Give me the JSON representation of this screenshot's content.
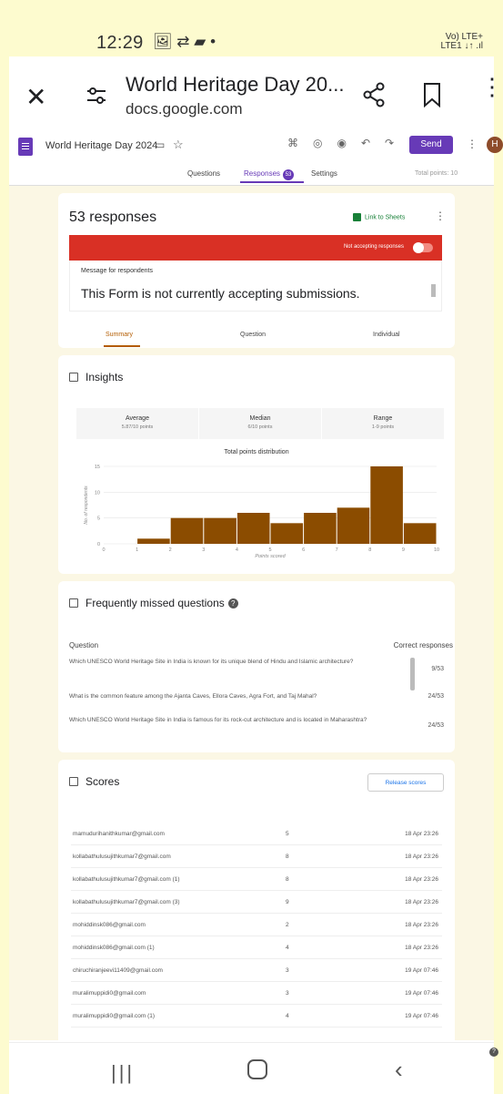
{
  "status_bar": {
    "time": "12:29",
    "icons": "🖼 ⇄ ▰ •",
    "network": "Vo) LTE+",
    "network2": "LTE1 ↓↑ .ıl"
  },
  "browser": {
    "title": "World Heritage Day 20...",
    "url": "docs.google.com"
  },
  "forms_bar": {
    "form_name": "World Heritage Day 2024",
    "send_label": "Send",
    "avatar_letter": "H",
    "tabs": {
      "questions": "Questions",
      "responses": "Responses",
      "responses_badge": "53",
      "settings": "Settings"
    },
    "total_points": "Total points: 10"
  },
  "responses_card": {
    "count_label": "53 responses",
    "link_to_sheets": "Link to Sheets",
    "banner_text": "Not accepting responses",
    "message_label": "Message for respondents",
    "message_text": "This Form is not currently accepting submissions.",
    "subtabs": {
      "summary": "Summary",
      "question": "Question",
      "individual": "Individual"
    }
  },
  "insights": {
    "title": "Insights",
    "average": {
      "label": "Average",
      "value": "5.87/10 points"
    },
    "median": {
      "label": "Median",
      "value": "6/10 points"
    },
    "range": {
      "label": "Range",
      "value": "1-9 points"
    }
  },
  "chart_data": {
    "type": "bar",
    "title": "Total points distribution",
    "xlabel": "Points scored",
    "ylabel": "No. of respondents",
    "categories": [
      "0",
      "1",
      "2",
      "3",
      "4",
      "5",
      "6",
      "7",
      "8",
      "9",
      "10"
    ],
    "values": [
      0,
      1,
      5,
      5,
      6,
      4,
      6,
      7,
      15,
      4,
      0
    ],
    "ylim": [
      0,
      15
    ],
    "yticks": [
      0,
      5,
      10,
      15
    ],
    "bar_color": "#8b4c00",
    "grid": true
  },
  "missed_questions": {
    "title": "Frequently missed questions",
    "header_question": "Question",
    "header_correct": "Correct responses",
    "rows": [
      {
        "question": "Which UNESCO World Heritage Site in India is known for its unique blend of Hindu and Islamic architecture?",
        "correct": "9/53"
      },
      {
        "question": "What is the common feature among the Ajanta Caves, Ellora Caves, Agra Fort, and Taj Mahal?",
        "correct": "24/53"
      },
      {
        "question": "Which UNESCO World Heritage Site in India is famous for its rock-cut architecture and is located in Maharashtra?",
        "correct": "24/53"
      }
    ]
  },
  "scores": {
    "title": "Scores",
    "release_label": "Release scores",
    "rows": [
      {
        "email": "mamudurihanithkumar@gmail.com",
        "score": "5",
        "date": "18 Apr 23:26"
      },
      {
        "email": "kollabathulusujithkumar7@gmail.com",
        "score": "8",
        "date": "18 Apr 23:26"
      },
      {
        "email": "kollabathulusujithkumar7@gmail.com (1)",
        "score": "8",
        "date": "18 Apr 23:26"
      },
      {
        "email": "kollabathulusujithkumar7@gmail.com (3)",
        "score": "9",
        "date": "18 Apr 23:26"
      },
      {
        "email": "mohiddinsk086@gmail.com",
        "score": "2",
        "date": "18 Apr 23:26"
      },
      {
        "email": "mohiddinsk086@gmail.com (1)",
        "score": "4",
        "date": "18 Apr 23:26"
      },
      {
        "email": "chiruchiranjeevi11409@gmail.com",
        "score": "3",
        "date": "19 Apr 07:46"
      },
      {
        "email": "muralimuppidi0@gmail.com",
        "score": "3",
        "date": "19 Apr 07:46"
      },
      {
        "email": "muralimuppidi0@gmail.com (1)",
        "score": "4",
        "date": "19 Apr 07:46"
      }
    ]
  },
  "help_icon": "?"
}
